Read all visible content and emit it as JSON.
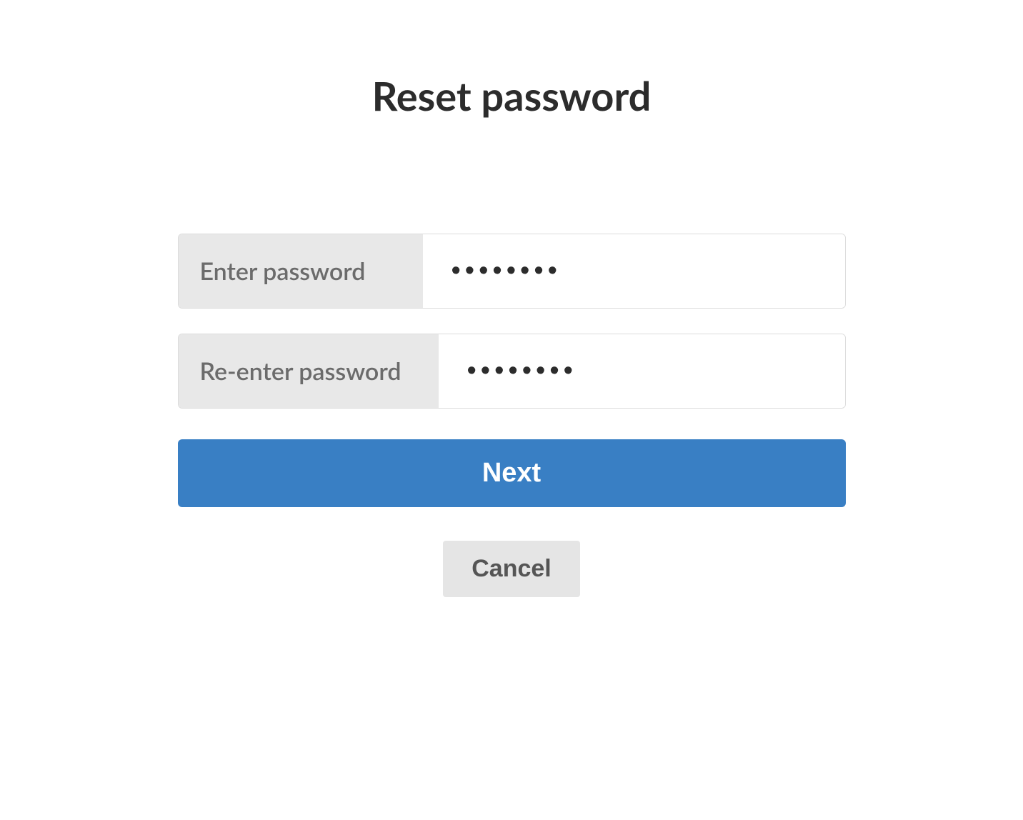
{
  "title": "Reset password",
  "form": {
    "password": {
      "label": "Enter password",
      "value": "••••••••"
    },
    "confirm_password": {
      "label": "Re-enter password",
      "value": "••••••••"
    },
    "next_button_label": "Next",
    "cancel_button_label": "Cancel"
  },
  "colors": {
    "primary": "#397fc4",
    "label_bg": "#e8e8e8",
    "cancel_bg": "#e5e5e5",
    "text_dark": "#2c2c2c",
    "text_muted": "#6b6b6b"
  }
}
